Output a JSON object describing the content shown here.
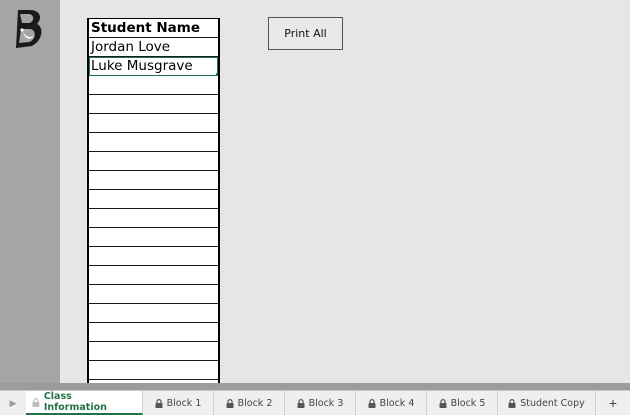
{
  "logo": {
    "icon": "brand-logo-icon"
  },
  "roster": {
    "header": "Student Name",
    "students": [
      "Jordan Love",
      "Luke Musgrave"
    ],
    "empty_rows": 16
  },
  "print_button": {
    "label": "Print All"
  },
  "sheet_tabs": [
    {
      "label": "Class Information",
      "active": true,
      "icon": "lock-icon"
    },
    {
      "label": "Block 1",
      "active": false,
      "icon": "lock-icon"
    },
    {
      "label": "Block 2",
      "active": false,
      "icon": "lock-icon"
    },
    {
      "label": "Block 3",
      "active": false,
      "icon": "lock-icon"
    },
    {
      "label": "Block 4",
      "active": false,
      "icon": "lock-icon"
    },
    {
      "label": "Block 5",
      "active": false,
      "icon": "lock-icon"
    },
    {
      "label": "Student Copy",
      "active": false,
      "icon": "lock-icon"
    }
  ],
  "add_sheet": {
    "label": "+"
  },
  "colors": {
    "accent": "#217346",
    "margin": "#a7a5a3",
    "canvas": "#e6e6e6"
  }
}
